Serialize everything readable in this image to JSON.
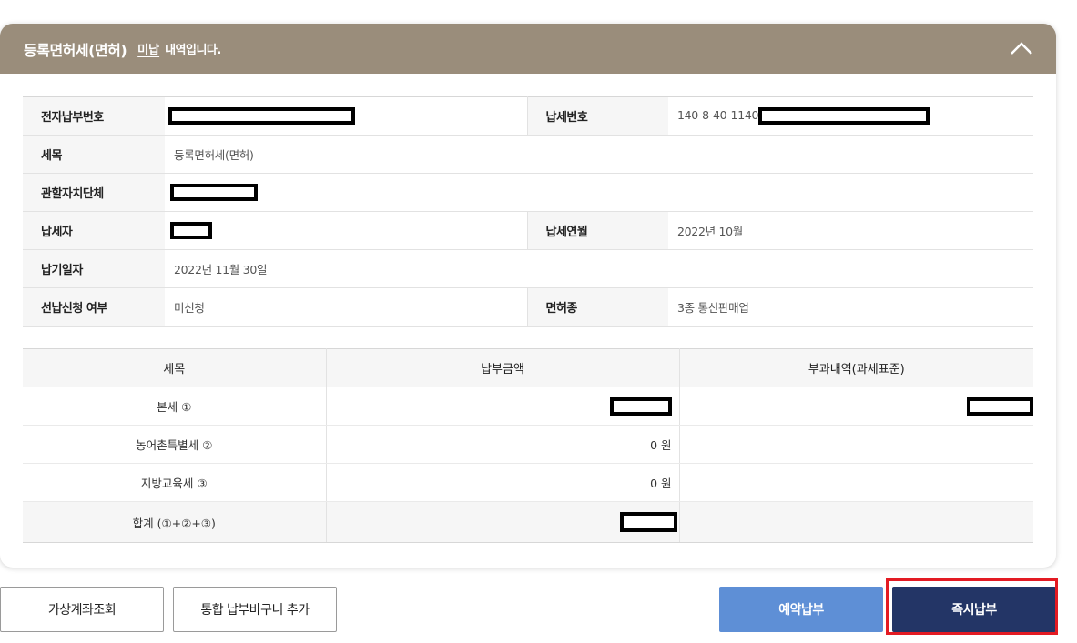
{
  "header": {
    "title": "등록면허세(면허)",
    "status": "미납",
    "suffix": "내역입니다."
  },
  "info": {
    "rows": [
      {
        "label1": "전자납부번호",
        "value1": "",
        "label2": "납세번호",
        "value2": "140-8-40-11400"
      },
      {
        "label1": "세목",
        "value1": "등록면허세(면허)"
      },
      {
        "label1": "관할자치단체",
        "value1": ""
      },
      {
        "label1": "납세자",
        "value1": "",
        "label2": "납세연월",
        "value2": "2022년 10월"
      },
      {
        "label1": "납기일자",
        "value1": "2022년 11월 30일"
      },
      {
        "label1": "선납신청 여부",
        "value1": "미신청",
        "label2": "면허종",
        "value2": "3종 통신판매업"
      }
    ]
  },
  "amounts": {
    "headers": [
      "세목",
      "납부금액",
      "부과내역(과세표준)"
    ],
    "rows": [
      {
        "name": "본세 ①",
        "amount": "",
        "basis": ""
      },
      {
        "name": "농어촌특별세 ②",
        "amount": "0 원",
        "basis": ""
      },
      {
        "name": "지방교육세 ③",
        "amount": "0 원",
        "basis": ""
      },
      {
        "name": "합계 (①+②+③)",
        "amount": "",
        "basis": ""
      }
    ]
  },
  "buttons": {
    "virtual_account": "가상계좌조회",
    "add_basket": "통합 납부바구니 추가",
    "reserve_pay": "예약납부",
    "pay_now": "즉시납부"
  },
  "colors": {
    "header_bg": "#9a8d7b",
    "reserve_btn": "#5e8fd6",
    "pay_btn": "#233566",
    "highlight": "#e31b23"
  }
}
